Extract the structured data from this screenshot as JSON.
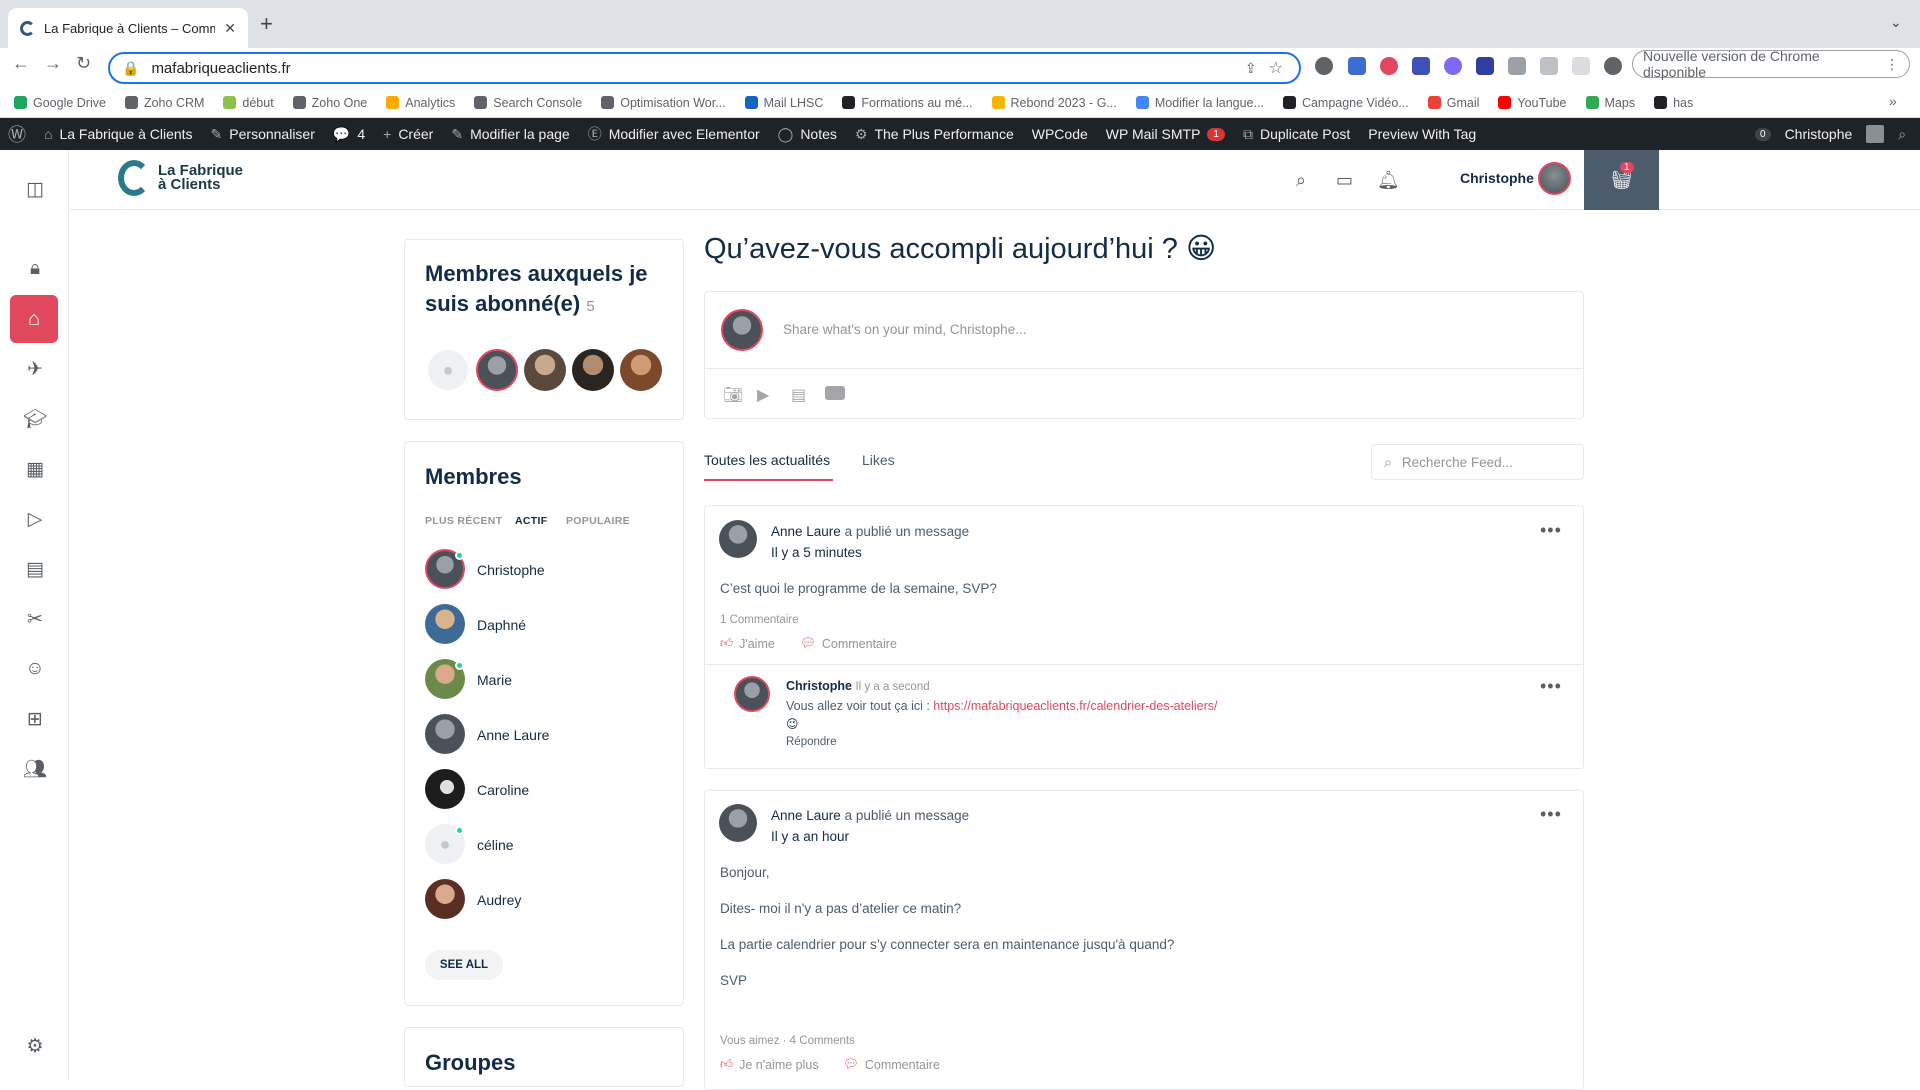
{
  "browser": {
    "tab_title": "La Fabrique à Clients – Comm",
    "url": "mafabriqueaclients.fr",
    "update_label": "Nouvelle version de Chrome disponible",
    "bookmarks": [
      {
        "label": "Google Drive",
        "color": "#1fa463"
      },
      {
        "label": "Zoho CRM",
        "color": "#5f6368"
      },
      {
        "label": "début",
        "color": "#8bc34a"
      },
      {
        "label": "Zoho One",
        "color": "#5f6368"
      },
      {
        "label": "Analytics",
        "color": "#f9ab00"
      },
      {
        "label": "Search Console",
        "color": "#5f6368"
      },
      {
        "label": "Optimisation Wor...",
        "color": "#5f6368"
      },
      {
        "label": "Mail LHSC",
        "color": "#1565c0"
      },
      {
        "label": "Formations au mé...",
        "color": "#202124"
      },
      {
        "label": "Rebond 2023 - G...",
        "color": "#f4b400"
      },
      {
        "label": "Modifier la langue...",
        "color": "#4285f4"
      },
      {
        "label": "Campagne Vidéo...",
        "color": "#202124"
      },
      {
        "label": "Gmail",
        "color": "#ea4335"
      },
      {
        "label": "YouTube",
        "color": "#ff0000"
      },
      {
        "label": "Maps",
        "color": "#34a853"
      },
      {
        "label": "has",
        "color": "#202124"
      }
    ]
  },
  "wpbar": {
    "site_name": "La Fabrique à Clients",
    "customize": "Personnaliser",
    "comments_count": "4",
    "create": "Créer",
    "edit_page": "Modifier la page",
    "edit_elementor": "Modifier avec Elementor",
    "notes": "Notes",
    "plus_perf": "The Plus Performance",
    "wpcode": "WPCode",
    "smtp": "WP Mail SMTP",
    "smtp_badge": "1",
    "duplicate": "Duplicate Post",
    "preview": "Preview With Tag",
    "updates_count": "0",
    "user": "Christophe"
  },
  "header": {
    "logo_line1": "La Fabrique",
    "logo_line2": "à Clients",
    "user_name": "Christophe",
    "cart_count": "1"
  },
  "following": {
    "title": "Membres auxquels je suis abonné(e)",
    "count": "5"
  },
  "members": {
    "title": "Membres",
    "tabs": [
      "PLUS RÉCENT",
      "ACTIF",
      "POPULAIRE"
    ],
    "list": [
      "Christophe",
      "Daphné",
      "Marie",
      "Anne Laure",
      "Caroline",
      "céline",
      "Audrey"
    ],
    "see_all": "SEE ALL"
  },
  "groups": {
    "title": "Groupes"
  },
  "feed": {
    "title": "Qu’avez-vous accompli aujourd’hui ? 😀",
    "placeholder": "Share what's on your mind, Christophe...",
    "tabs": [
      "Toutes les actualités",
      "Likes"
    ],
    "search_placeholder": "Recherche Feed...",
    "post1": {
      "author": "Anne Laure",
      "action": "a publié un message",
      "time": "Il y a 5 minutes",
      "text": "C’est quoi le programme de la semaine, SVP?",
      "comments_count": "1 Commentaire",
      "like": "J'aime",
      "comment": "Commentaire",
      "reply": {
        "author": "Christophe",
        "time": "Il y a a second",
        "text": "Vous allez voir tout ça ici : ",
        "link": "https://mafabriqueaclients.fr/calendrier-des-ateliers/",
        "emoji": "😉",
        "reply_label": "Répondre"
      }
    },
    "post2": {
      "author": "Anne Laure",
      "action": "a publié un message",
      "time": "Il y a an hour",
      "lines": [
        "Bonjour,",
        "Dites- moi il n'y a pas d’atelier ce matin?",
        "La partie calendrier pour s’y connecter sera en maintenance jusqu'à quand?",
        "SVP"
      ],
      "stats": "Vous aimez · 4 Comments",
      "unlike": "Je n'aime plus",
      "comment": "Commentaire"
    }
  }
}
